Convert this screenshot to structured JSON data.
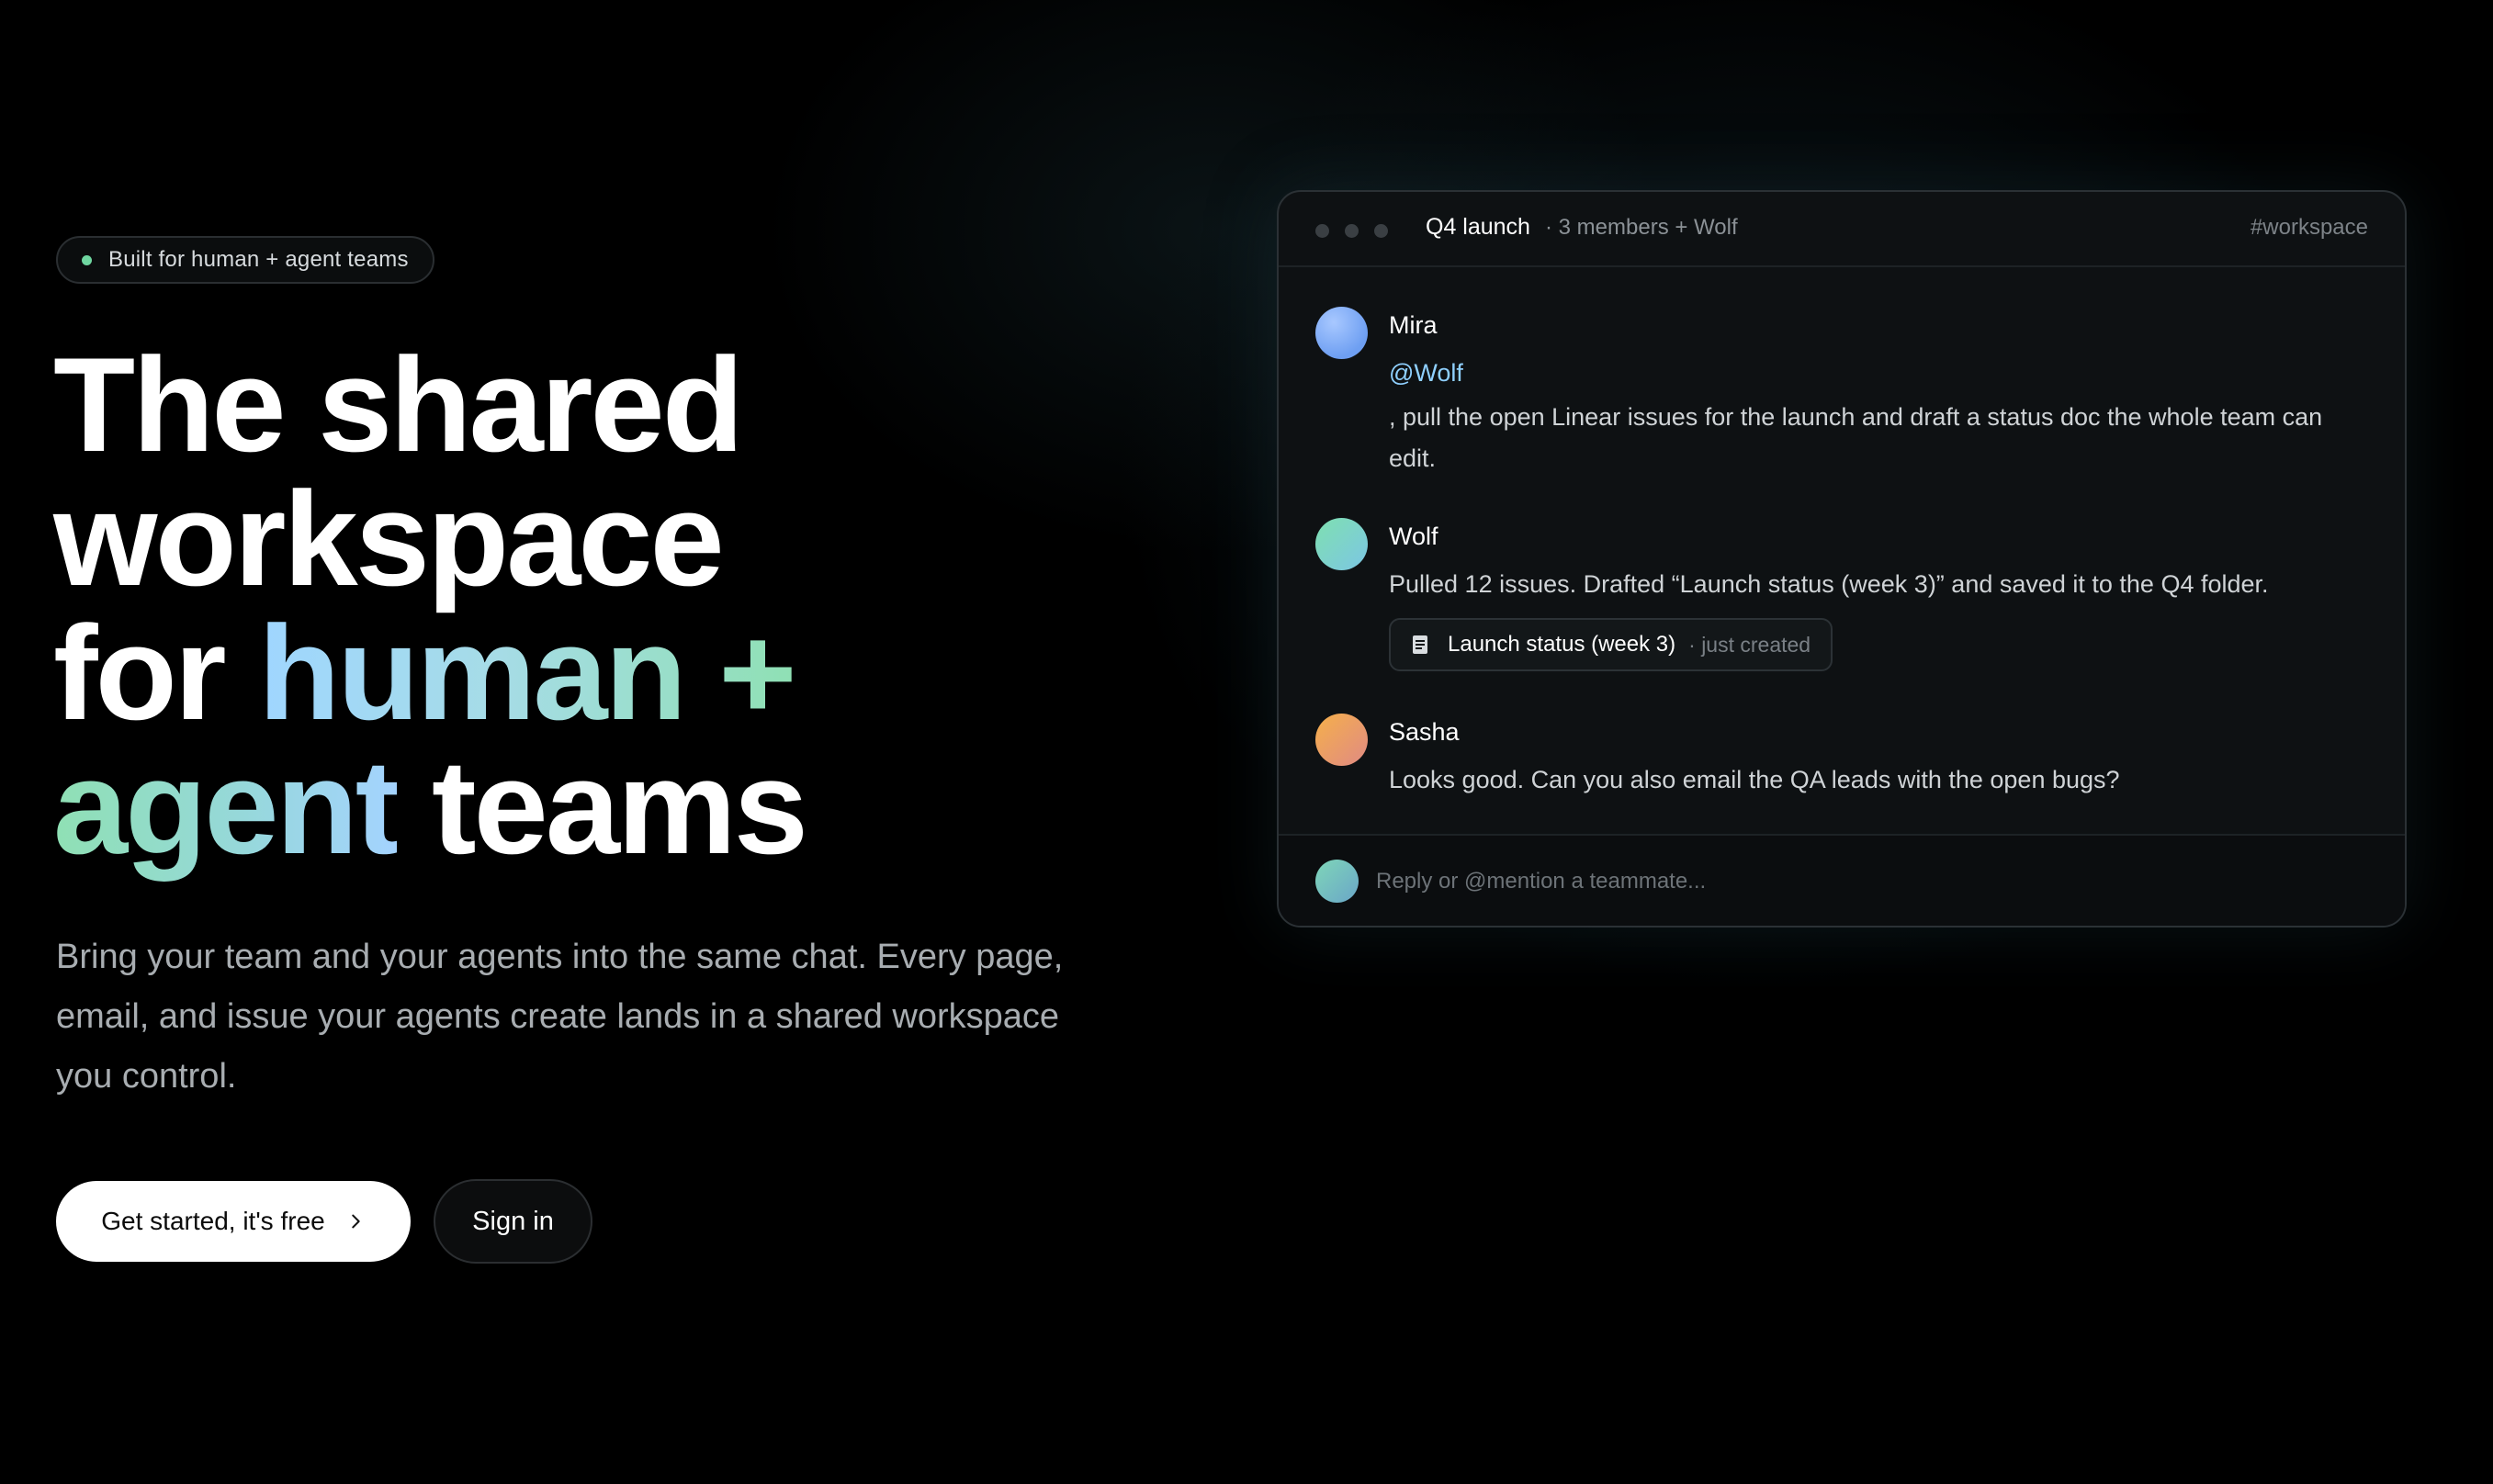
{
  "hero": {
    "badge": "Built for human + agent teams",
    "headline": {
      "line1": "The shared",
      "line2": "workspace",
      "line3_plain": "for ",
      "line3_grad": "human +",
      "line4_grad": "agent",
      "line4_plain": " teams"
    },
    "subtitle": "Bring your team and your agents into the same chat. Every page, email, and issue your agents create lands in a shared workspace you control.",
    "primary_cta": "Get started, it's free",
    "secondary_cta": "Sign in"
  },
  "chat": {
    "title": "Q4 launch",
    "meta": "· 3 members + Wolf",
    "channel": "#workspace",
    "messages": [
      {
        "author": "Mira",
        "mention": "@Wolf",
        "text": ", pull the open Linear issues for the launch and draft a status doc the whole team can edit."
      },
      {
        "author": "Wolf",
        "text": "Pulled 12 issues. Drafted “Launch status (week 3)” and saved it to the Q4 folder.",
        "attachment": {
          "title": "Launch status (week 3)",
          "status": "· just created"
        }
      },
      {
        "author": "Sasha",
        "text": "Looks good. Can you also email the QA leads with the open bugs?"
      }
    ],
    "input_placeholder": "Reply or @mention a teammate..."
  },
  "colors": {
    "accent_green": "#6fd6a0",
    "mention_blue": "#8fd0ff",
    "background": "#000000"
  },
  "icons": {
    "cta_arrow": "chevron-right-icon",
    "attachment": "document-icon"
  }
}
